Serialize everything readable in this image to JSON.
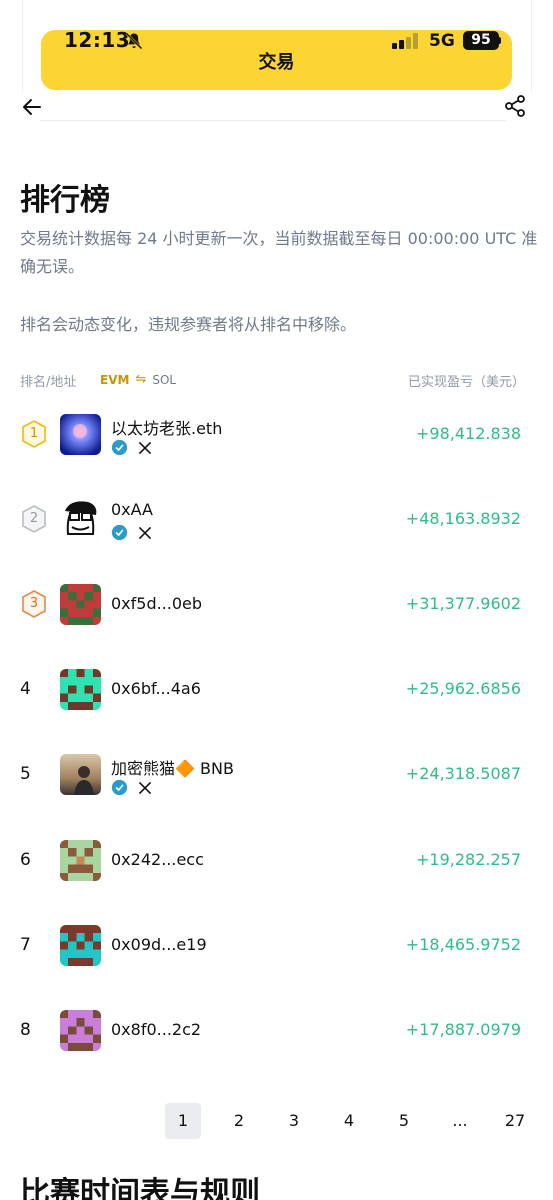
{
  "status_bar": {
    "time": "12:13",
    "network": "5G",
    "battery": "95"
  },
  "top_bar": {
    "title": "交易"
  },
  "header": {
    "title": "排行榜",
    "description_1": "交易统计数据每 24 小时更新一次，当前数据截至每日 00:00:00 UTC 准确无误。",
    "description_2": "排名会动态变化，违规参赛者将从排名中移除。"
  },
  "table": {
    "rank_header": "排名/地址",
    "chain_evm": "EVM",
    "chain_swap": "⇋",
    "chain_sol": "SOL",
    "pnl_header": "已实现盈亏（美元）",
    "rows": [
      {
        "rank": "1",
        "name": "以太坊老张.eth",
        "verified": true,
        "pnl": "+98,412.838",
        "avatar": "blue-gradient"
      },
      {
        "rank": "2",
        "name": "0xAA",
        "verified": true,
        "pnl": "+48,163.8932",
        "avatar": "sketch-face"
      },
      {
        "rank": "3",
        "name": "0xf5d...0eb",
        "verified": false,
        "pnl": "+31,377.9602",
        "avatar": "pixel-red-green"
      },
      {
        "rank": "4",
        "name": "0x6bf...4a6",
        "verified": false,
        "pnl": "+25,962.6856",
        "avatar": "pixel-teal-brown"
      },
      {
        "rank": "5",
        "name": "加密熊猫🔶 BNB",
        "verified": true,
        "pnl": "+24,318.5087",
        "avatar": "photo-portrait"
      },
      {
        "rank": "6",
        "name": "0x242...ecc",
        "verified": false,
        "pnl": "+19,282.257",
        "avatar": "pixel-green-brown"
      },
      {
        "rank": "7",
        "name": "0x09d...e19",
        "verified": false,
        "pnl": "+18,465.9752",
        "avatar": "pixel-cyan-brown"
      },
      {
        "rank": "8",
        "name": "0x8f0...2c2",
        "verified": false,
        "pnl": "+17,887.0979",
        "avatar": "pixel-purple"
      }
    ]
  },
  "pagination": {
    "pages": [
      "1",
      "2",
      "3",
      "4",
      "5",
      "...",
      "27"
    ],
    "current": "1"
  },
  "next_section": {
    "title": "比赛时间表与规则"
  },
  "colors": {
    "accent_yellow": "#FCD535",
    "profit_green": "#2EBD85",
    "muted_text": "#707A8A",
    "medal_gold": "#F0B90B",
    "medal_silver": "#B7BDC6",
    "medal_bronze": "#E08A4B"
  }
}
